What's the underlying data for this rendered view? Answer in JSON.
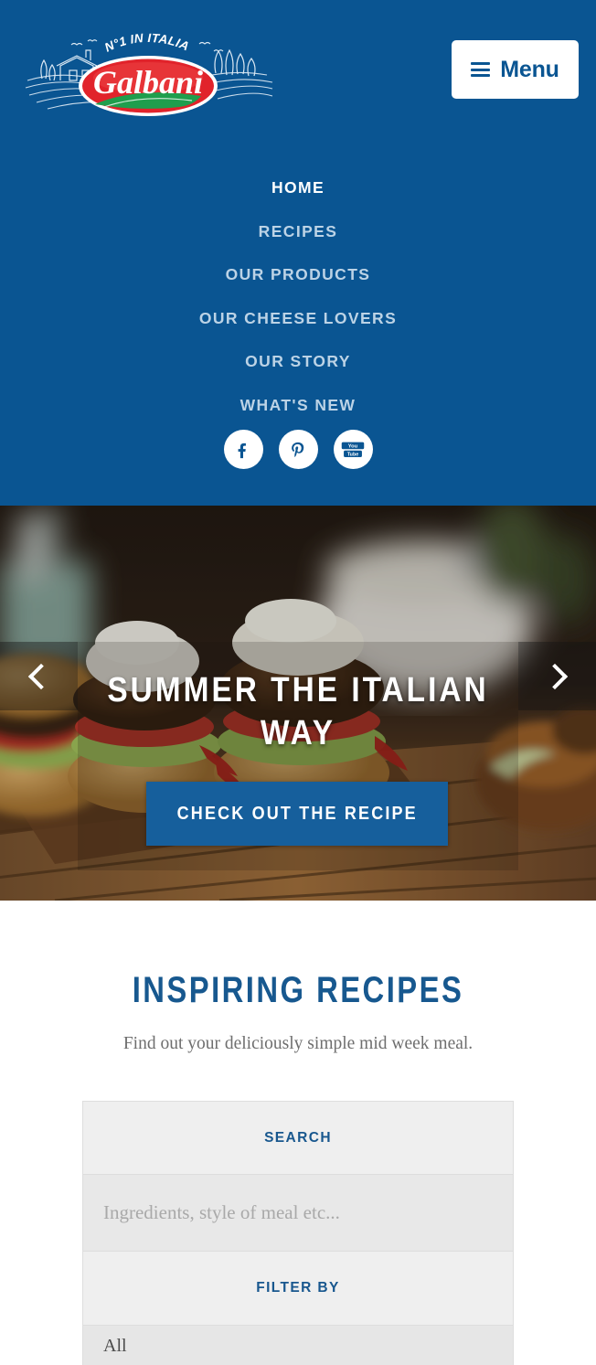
{
  "brand": {
    "name": "Galbani",
    "tagline_prefix": "N°",
    "tagline_number": "1",
    "tagline_suffix": "IN ITALIA",
    "header_bg": "#0a5592",
    "accent_blue": "#165f9c",
    "logo_red": "#e1232b",
    "logo_green": "#1f9e4d"
  },
  "header": {
    "menu_button_label": "Menu"
  },
  "nav": {
    "items": [
      {
        "label": "HOME",
        "active": true
      },
      {
        "label": "RECIPES",
        "active": false
      },
      {
        "label": "OUR PRODUCTS",
        "active": false
      },
      {
        "label": "OUR CHEESE LOVERS",
        "active": false
      },
      {
        "label": "OUR STORY",
        "active": false
      },
      {
        "label": "WHAT'S NEW",
        "active": false
      }
    ],
    "social": [
      {
        "name": "facebook",
        "glyph": "f"
      },
      {
        "name": "pinterest",
        "glyph": "P"
      },
      {
        "name": "youtube",
        "glyph": "YouTube"
      }
    ]
  },
  "hero": {
    "title": "SUMMER THE ITALIAN WAY",
    "cta_label": "CHECK OUT THE RECIPE",
    "prev_label": "Previous slide",
    "next_label": "Next slide"
  },
  "recipes": {
    "title": "INSPIRING RECIPES",
    "subtitle": "Find out your deliciously simple mid week meal."
  },
  "search_panel": {
    "search_heading": "SEARCH",
    "search_placeholder": "Ingredients, style of meal etc...",
    "search_value": "",
    "filter_heading": "FILTER BY",
    "filter_selected": "All"
  }
}
